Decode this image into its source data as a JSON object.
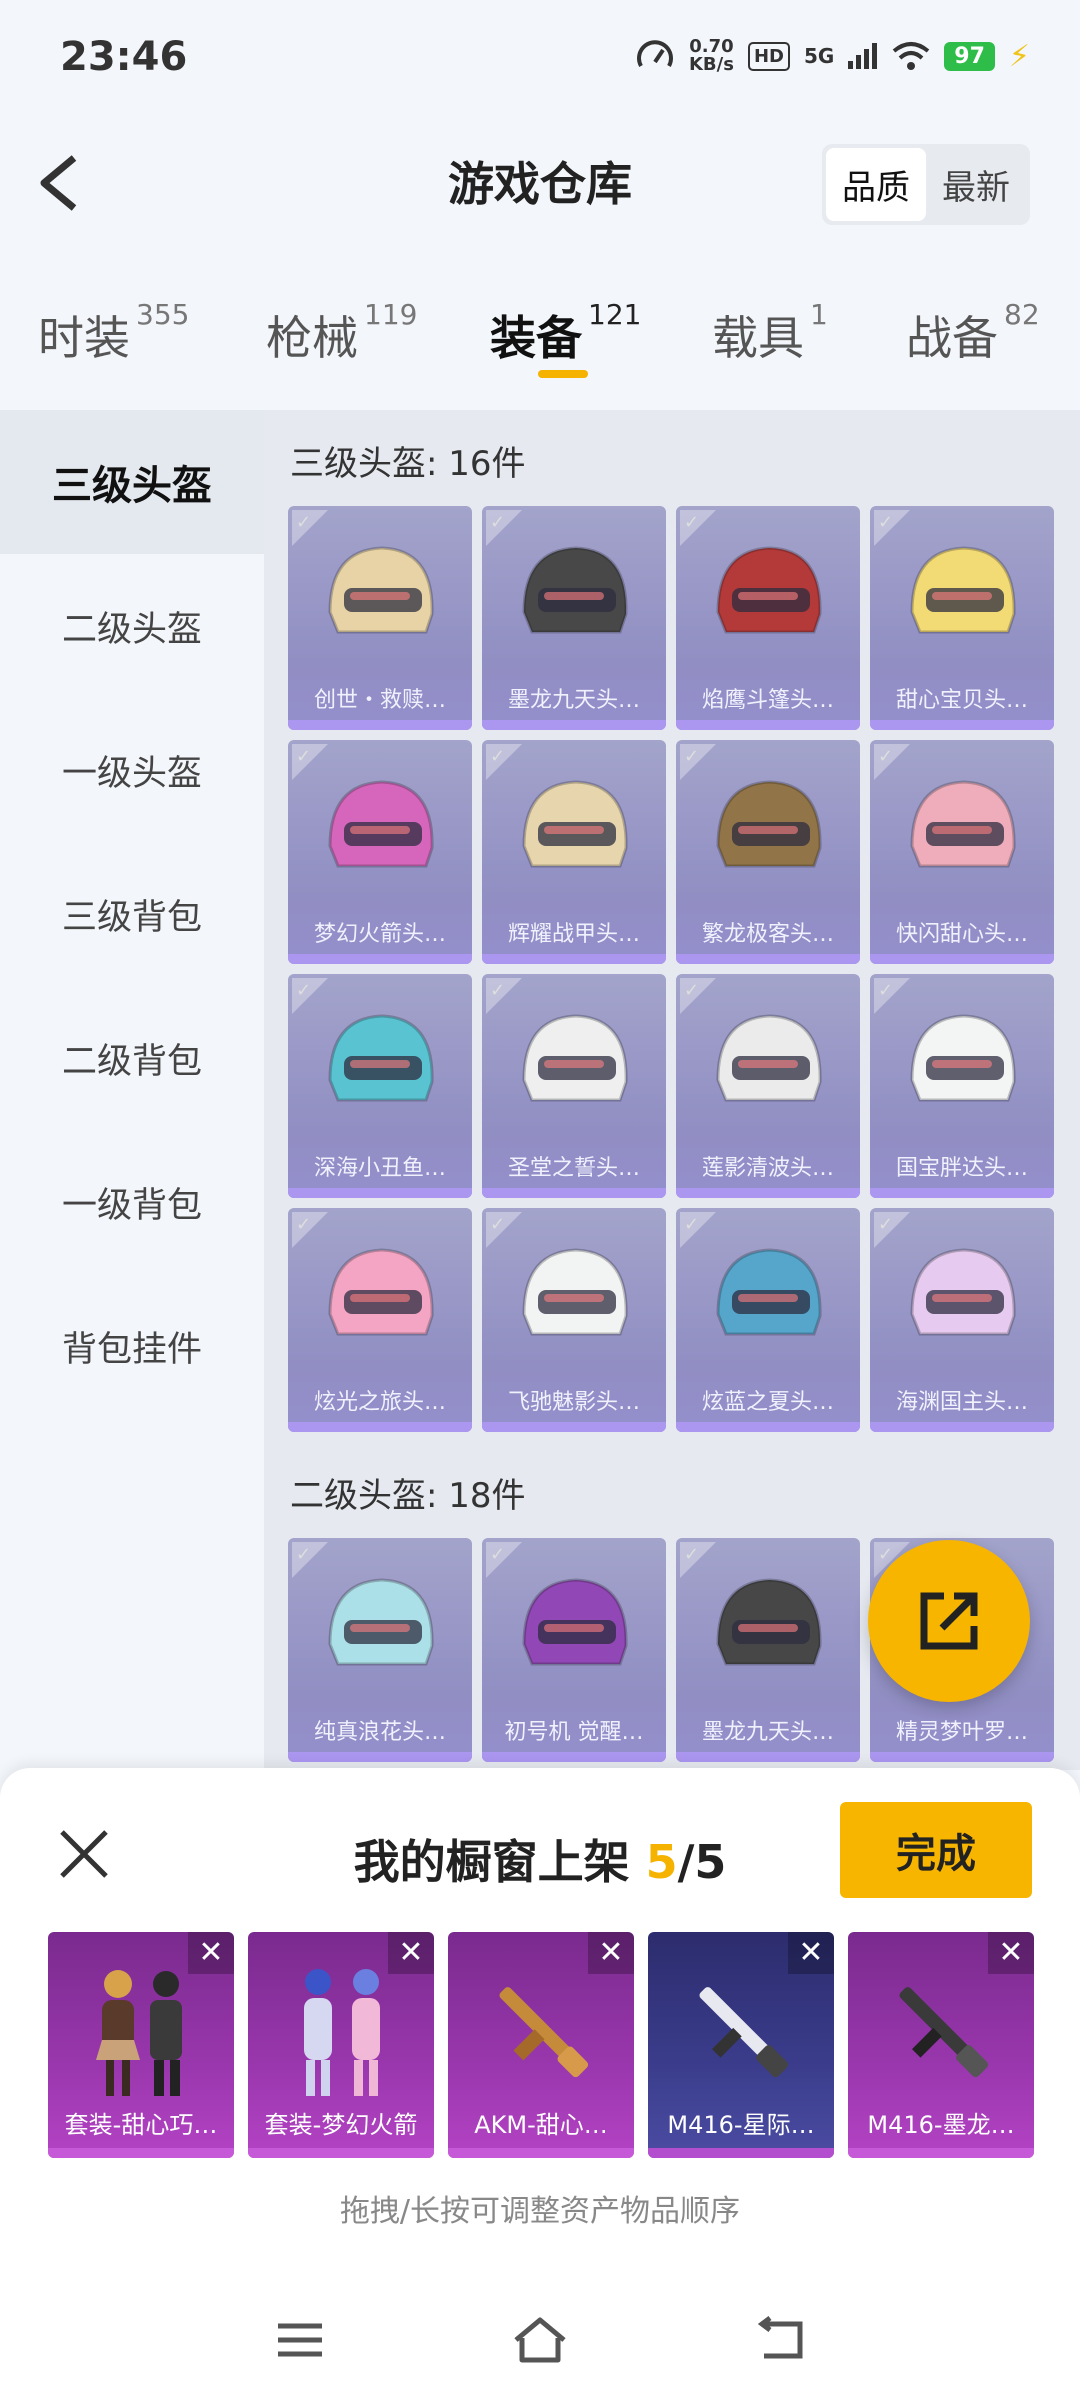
{
  "status_bar": {
    "time": "23:46",
    "net_speed_value": "0.70",
    "net_speed_unit": "KB/s",
    "hd": "HD",
    "network": "5G",
    "battery": "97"
  },
  "header": {
    "title": "游戏仓库",
    "sort_options": [
      "品质",
      "最新"
    ],
    "active_sort": "品质"
  },
  "tabs": [
    {
      "label": "时装",
      "count": "355"
    },
    {
      "label": "枪械",
      "count": "119"
    },
    {
      "label": "装备",
      "count": "121",
      "active": true
    },
    {
      "label": "载具",
      "count": "1"
    },
    {
      "label": "战备",
      "count": "82"
    }
  ],
  "sidebar": {
    "items": [
      "三级头盔",
      "二级头盔",
      "一级头盔",
      "三级背包",
      "二级背包",
      "一级背包",
      "背包挂件"
    ],
    "active": "三级头盔"
  },
  "sections": [
    {
      "title": "三级头盔: 16件",
      "items": [
        "创世・救赎…",
        "墨龙九天头…",
        "焰鹰斗篷头…",
        "甜心宝贝头…",
        "梦幻火箭头…",
        "辉耀战甲头…",
        "繁龙极客头…",
        "快闪甜心头…",
        "深海小丑鱼…",
        "圣堂之誓头…",
        "莲影清波头…",
        "国宝胖达头…",
        "炫光之旅头…",
        "飞驰魅影头…",
        "炫蓝之夏头…",
        "海渊国主头…"
      ]
    },
    {
      "title": "二级头盔: 18件",
      "items": [
        "纯真浪花头…",
        "初号机 觉醒…",
        "墨龙九天头…",
        "精灵梦叶罗…"
      ]
    }
  ],
  "showcase": {
    "title_prefix": "我的橱窗上架 ",
    "count": "5",
    "separator": "/",
    "max": "5",
    "done_label": "完成",
    "remove_glyph": "✕",
    "items": [
      "套装-甜心巧…",
      "套装-梦幻火箭",
      "AKM-甜心…",
      "M416-星际…",
      "M416-墨龙…"
    ],
    "hint": "拖拽/长按可调整资产物品顺序"
  },
  "colors": {
    "accent": "#f7b500",
    "card_purple": "#8a87c0",
    "shelf_purple": "#9a37ae",
    "shelf_blue": "#3b3d8c"
  },
  "icons": {
    "back": "chevron-left-icon",
    "share": "share-icon",
    "close": "close-icon",
    "menu": "menu-icon",
    "home": "home-icon",
    "return": "back-icon"
  }
}
